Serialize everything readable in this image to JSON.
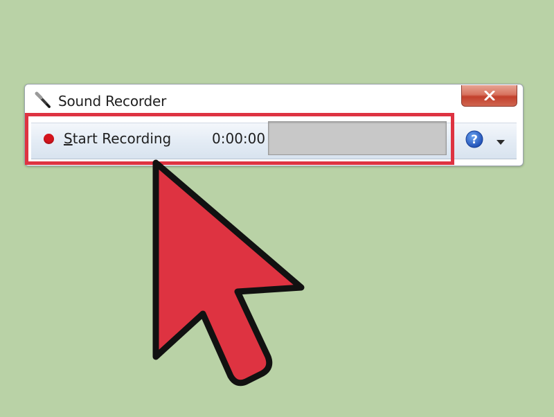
{
  "window": {
    "title": "Sound Recorder",
    "app_icon": "microphone-icon",
    "close_icon": "close-icon"
  },
  "toolbar": {
    "record_icon": "record-dot-icon",
    "start_recording_first": "S",
    "start_recording_rest": "tart Recording",
    "time": "0:00:00",
    "level": 0,
    "help_icon": "help-icon",
    "menu_icon": "chevron-down-icon"
  },
  "overlay": {
    "highlight_color": "#de3341",
    "arrow_color": "#de3341"
  },
  "colors": {
    "background": "#b9d2a6",
    "close_button": "#c2402c",
    "record_dot": "#d4141c",
    "help_blue": "#1f5cc8"
  }
}
